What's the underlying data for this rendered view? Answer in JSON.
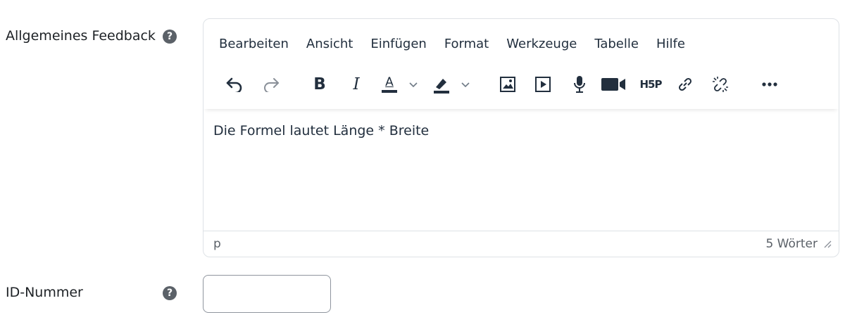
{
  "feedback": {
    "label": "Allgemeines Feedback",
    "help_icon": "question-circle-icon"
  },
  "editor": {
    "menu": [
      "Bearbeiten",
      "Ansicht",
      "Einfügen",
      "Format",
      "Werkzeuge",
      "Tabelle",
      "Hilfe"
    ],
    "toolbar": {
      "bold": "B",
      "italic": "I",
      "text_color": "A",
      "h5p": "H5P",
      "icons": [
        "undo-icon",
        "redo-icon",
        "bold-icon",
        "italic-icon",
        "text-color-icon",
        "chevron-down-icon",
        "highlight-icon",
        "chevron-down-icon",
        "image-icon",
        "media-icon",
        "microphone-icon",
        "video-camera-icon",
        "h5p-icon",
        "link-icon",
        "unlink-icon",
        "more-icon"
      ]
    },
    "content": "Die Formel lautet Länge * Breite",
    "status_path": "p",
    "word_count": "5 Wörter"
  },
  "id_number": {
    "label": "ID-Nummer",
    "value": ""
  },
  "colors": {
    "text": "#1d2125",
    "toolbar_text": "#222f3e",
    "border": "#dee2e6",
    "help_icon_bg": "#5b6168"
  }
}
